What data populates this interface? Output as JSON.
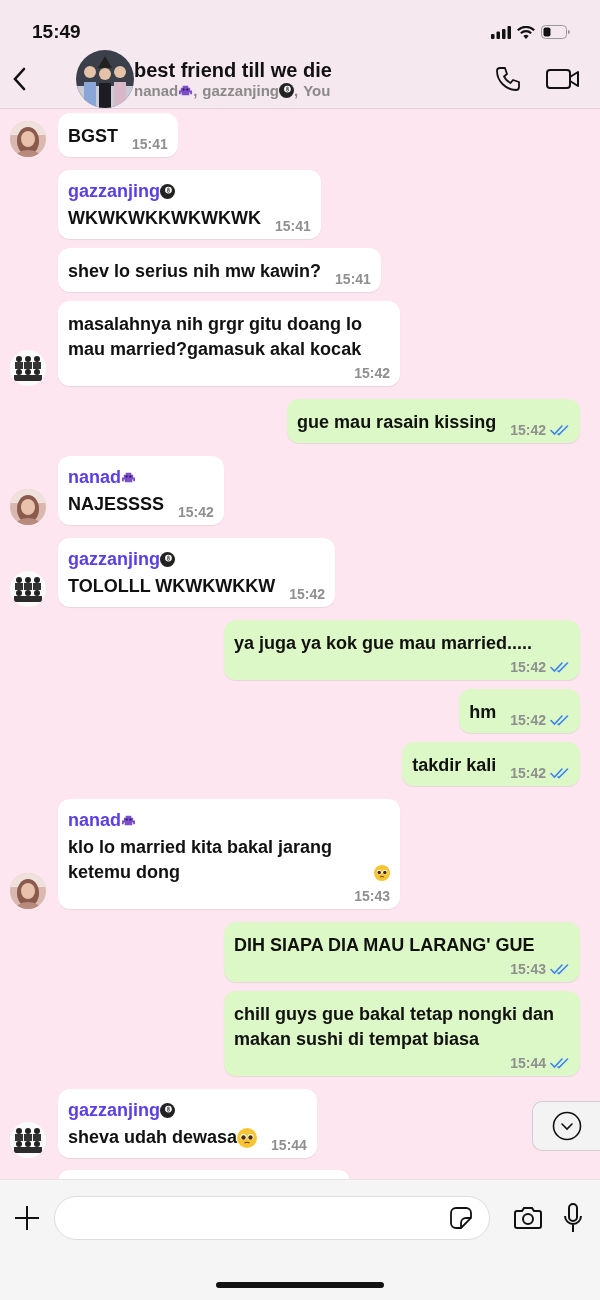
{
  "status_bar": {
    "time": "15:49"
  },
  "header": {
    "title": "best friend till we die",
    "members": [
      {
        "name": "nanad",
        "kind": "alien",
        "sep": ","
      },
      {
        "name": "gazzanjing",
        "kind": "eightball",
        "sep": ","
      },
      {
        "name": "You"
      }
    ]
  },
  "messages": [
    {
      "outgoing": false,
      "avatar": true,
      "text": "BGST",
      "time": "15:41"
    },
    {
      "outgoing": false,
      "avatar": false,
      "sender": {
        "name": "gazzanjing",
        "kind": "eightball"
      },
      "text": "WKWKWKKWKWKWK",
      "time": "15:41"
    },
    {
      "outgoing": false,
      "avatar": false,
      "text": "shev lo serius nih mw kawin?",
      "time": "15:41"
    },
    {
      "outgoing": false,
      "avatar": true,
      "text": "masalahnya nih grgr gitu doang lo mau married?gamasuk akal kocak",
      "time": "15:42"
    },
    {
      "outgoing": true,
      "text": "gue mau rasain kissing",
      "time": "15:42",
      "read": true
    },
    {
      "outgoing": false,
      "avatar": true,
      "sender": {
        "name": "nanad",
        "kind": "alien"
      },
      "text": "NAJESSSS",
      "time": "15:42"
    },
    {
      "outgoing": false,
      "avatar": true,
      "sender": {
        "name": "gazzanjing",
        "kind": "eightball"
      },
      "text": "TOLOLLL WKWKWKKW",
      "time": "15:42"
    },
    {
      "outgoing": true,
      "text": "ya juga ya kok gue mau married.....",
      "time": "15:42",
      "read": true
    },
    {
      "outgoing": true,
      "text": "hm",
      "time": "15:42",
      "read": true
    },
    {
      "outgoing": true,
      "text": "takdir kali",
      "time": "15:42",
      "read": true
    },
    {
      "outgoing": false,
      "avatar": true,
      "sender": {
        "name": "nanad",
        "kind": "alien"
      },
      "text": "klo lo married kita bakal jarang ketemu dong",
      "pleading_emoji": true,
      "time": "15:43"
    },
    {
      "outgoing": true,
      "text": "DIH SIAPA DIA MAU LARANG' GUE",
      "time": "15:43",
      "read": true
    },
    {
      "outgoing": true,
      "text": "chill guys gue bakal tetap nongki dan makan sushi di tempat biasa",
      "time": "15:44",
      "read": true
    },
    {
      "outgoing": false,
      "avatar": true,
      "sender": {
        "name": "gazzanjing",
        "kind": "eightball"
      },
      "text": "sheva udah dewasa",
      "pleading_emoji": true,
      "time": "15:44"
    }
  ]
}
